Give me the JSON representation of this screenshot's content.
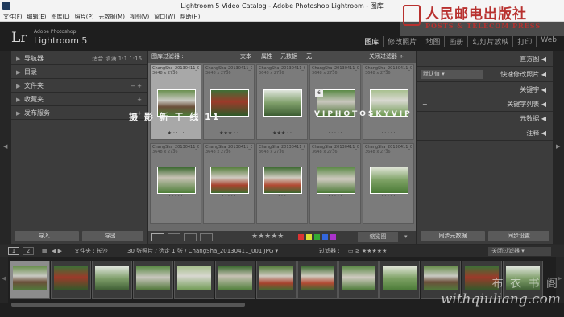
{
  "window": {
    "title": "Lightroom 5 Video Catalog - Adobe Photoshop Lightroom - 图库"
  },
  "menu": [
    "文件(F)",
    "编辑(E)",
    "图库(L)",
    "照片(P)",
    "元数据(M)",
    "视图(V)",
    "窗口(W)",
    "帮助(H)"
  ],
  "identity": {
    "lr": "Lr",
    "brand": "Adobe Photoshop",
    "product": "Lightroom 5"
  },
  "modules": [
    "图库",
    "修改照片",
    "地图",
    "画册",
    "幻灯片放映",
    "打印",
    "Web"
  ],
  "left_panel": {
    "navigator": "导航器",
    "nav_zoom": [
      "适合",
      "填满",
      "1:1",
      "1:16"
    ],
    "catalog": "目录",
    "folders": "文件夹",
    "collections": "收藏夹",
    "publish": "发布服务",
    "import": "导入...",
    "export": "导出..."
  },
  "filter": {
    "label": "图库过滤器 :",
    "tabs": [
      "文本",
      "属性",
      "元数据",
      "无"
    ],
    "off": "关闭过滤器 ÷"
  },
  "grid": {
    "cells": [
      {
        "name": "ChangSha_20130411_0...",
        "dims": "3648 x 2736",
        "stars": "★ · · · ·",
        "selected": true
      },
      {
        "name": "ChangSha_20130411_0...",
        "dims": "3648 x 2736",
        "stars": "★★★ · ·",
        "selected": false
      },
      {
        "name": "ChangSha_20130411_0...",
        "dims": "3648 x 2736",
        "stars": "★★★ · ·",
        "selected": false
      },
      {
        "name": "ChangSha_20130411_0...",
        "dims": "3648 x 2736",
        "stars": "· · · · ·",
        "selected": false
      },
      {
        "name": "ChangSha_20130411_0...",
        "dims": "3648 x 2736",
        "stars": "· · · · ·",
        "selected": false
      },
      {
        "name": "ChangSha_20130411_0...",
        "dims": "3648 x 2736",
        "stars": "· · · · ·",
        "selected": false
      },
      {
        "name": "ChangSha_20130411_0...",
        "dims": "3648 x 2736",
        "stars": "· · · · ·",
        "selected": false
      },
      {
        "name": "ChangSha_20130411_0...",
        "dims": "3648 x 2736",
        "stars": "· · · · ·",
        "selected": false
      },
      {
        "name": "ChangSha_20130411_0...",
        "dims": "3648 x 2736",
        "stars": "· · · · ·",
        "selected": false
      },
      {
        "name": "ChangSha_20130411_0...",
        "dims": "3648 x 2736",
        "stars": "· · · · ·",
        "selected": false
      }
    ],
    "badge": "6"
  },
  "toolbar": {
    "stars": "★★★★★",
    "sort": "缩览图"
  },
  "right_panel": {
    "histogram": "直方图",
    "preset_value": "默认值",
    "quick_develop": "快速修改照片",
    "keywording": "关键字",
    "keyword_list": "关键字列表",
    "metadata": "元数据",
    "comments": "注释",
    "sync_meta": "同步元数据",
    "sync_settings": "同步设置"
  },
  "filmstrip": {
    "pages": [
      "1",
      "2"
    ],
    "source": "文件夹 : 长沙",
    "count": "30 张照片 / 选定 1 张 / ChangSha_20130411_001.JPG ▾",
    "filter_label": "过滤器 :",
    "filter_off": "关闭过滤器"
  },
  "watermarks": {
    "publisher_cn": "人民邮电出版社",
    "publisher_en": "POSTS & TELECOM PRESS",
    "center": "摄    影    新    干    线      11",
    "center_en": "VIPHOTOSKYVIP",
    "bottom_cn": "布 衣 书 阁",
    "bottom_url": "withqiuliang.com"
  },
  "colors": {
    "accent_red": "#b8312f",
    "label_red": "#d33",
    "label_yellow": "#dd3",
    "label_green": "#3a3",
    "label_blue": "#36d",
    "label_purple": "#a3c"
  }
}
